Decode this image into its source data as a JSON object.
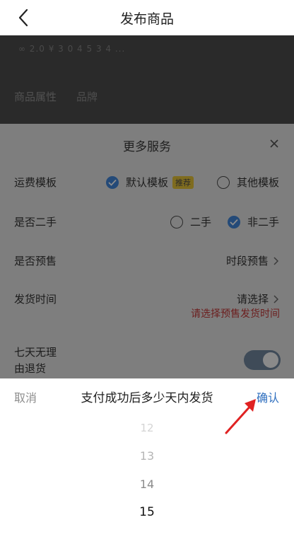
{
  "header": {
    "title": "发布商品"
  },
  "underlying": {
    "line_text": "∞ 2.0 ¥ 3 0 4 5 3 4 ...",
    "label": "商品属性",
    "value": "品牌"
  },
  "more_services": {
    "title": "更多服务",
    "shipping_template": {
      "label": "运费模板",
      "options": [
        {
          "label": "默认模板",
          "selected": true,
          "badge": "推荐"
        },
        {
          "label": "其他模板",
          "selected": false
        }
      ]
    },
    "second_hand": {
      "label": "是否二手",
      "options": [
        {
          "label": "二手",
          "selected": false
        },
        {
          "label": "非二手",
          "selected": true
        }
      ]
    },
    "presale": {
      "label": "是否预售",
      "value": "时段预售"
    },
    "ship_time": {
      "label": "发货时间",
      "value": "请选择",
      "warning": "请选择预售发货时间"
    },
    "seven_day_return": {
      "label_line1": "七天无理",
      "label_line2": "由退货",
      "enabled": true
    }
  },
  "picker": {
    "cancel_label": "取消",
    "title": "支付成功后多少天内发货",
    "confirm_label": "确认",
    "items": [
      "12",
      "13",
      "14",
      "15"
    ],
    "selected": "15"
  },
  "colors": {
    "confirm": "#2f6fbf",
    "arrow": "#e02222",
    "warning": "#6c1e1e"
  }
}
